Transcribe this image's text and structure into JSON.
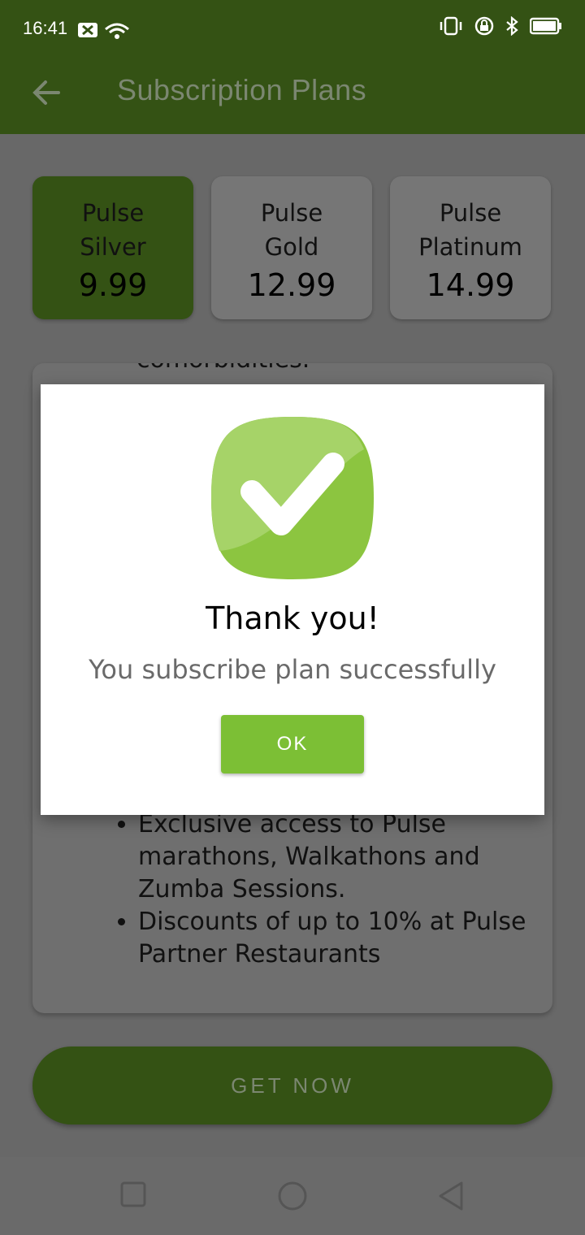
{
  "status": {
    "time": "16:41"
  },
  "appbar": {
    "title": "Subscription Plans"
  },
  "plans": [
    {
      "name1": "Pulse",
      "name2": "Silver",
      "price": "9.99"
    },
    {
      "name1": "Pulse",
      "name2": "Gold",
      "price": "12.99"
    },
    {
      "name1": "Pulse",
      "name2": "Platinum",
      "price": "14.99"
    }
  ],
  "card": {
    "partial_top": "comorbidities.",
    "bullets": [
      "Exclusive access to Pulse marathons, Walkathons and Zumba Sessions.",
      "Discounts of up to 10% at Pulse Partner Restaurants"
    ]
  },
  "get_now": "GET NOW",
  "dialog": {
    "title": "Thank you!",
    "message": "You subscribe plan successfully",
    "ok": "OK"
  },
  "colors": {
    "primary": "#345214",
    "accent": "#7cbf35"
  }
}
